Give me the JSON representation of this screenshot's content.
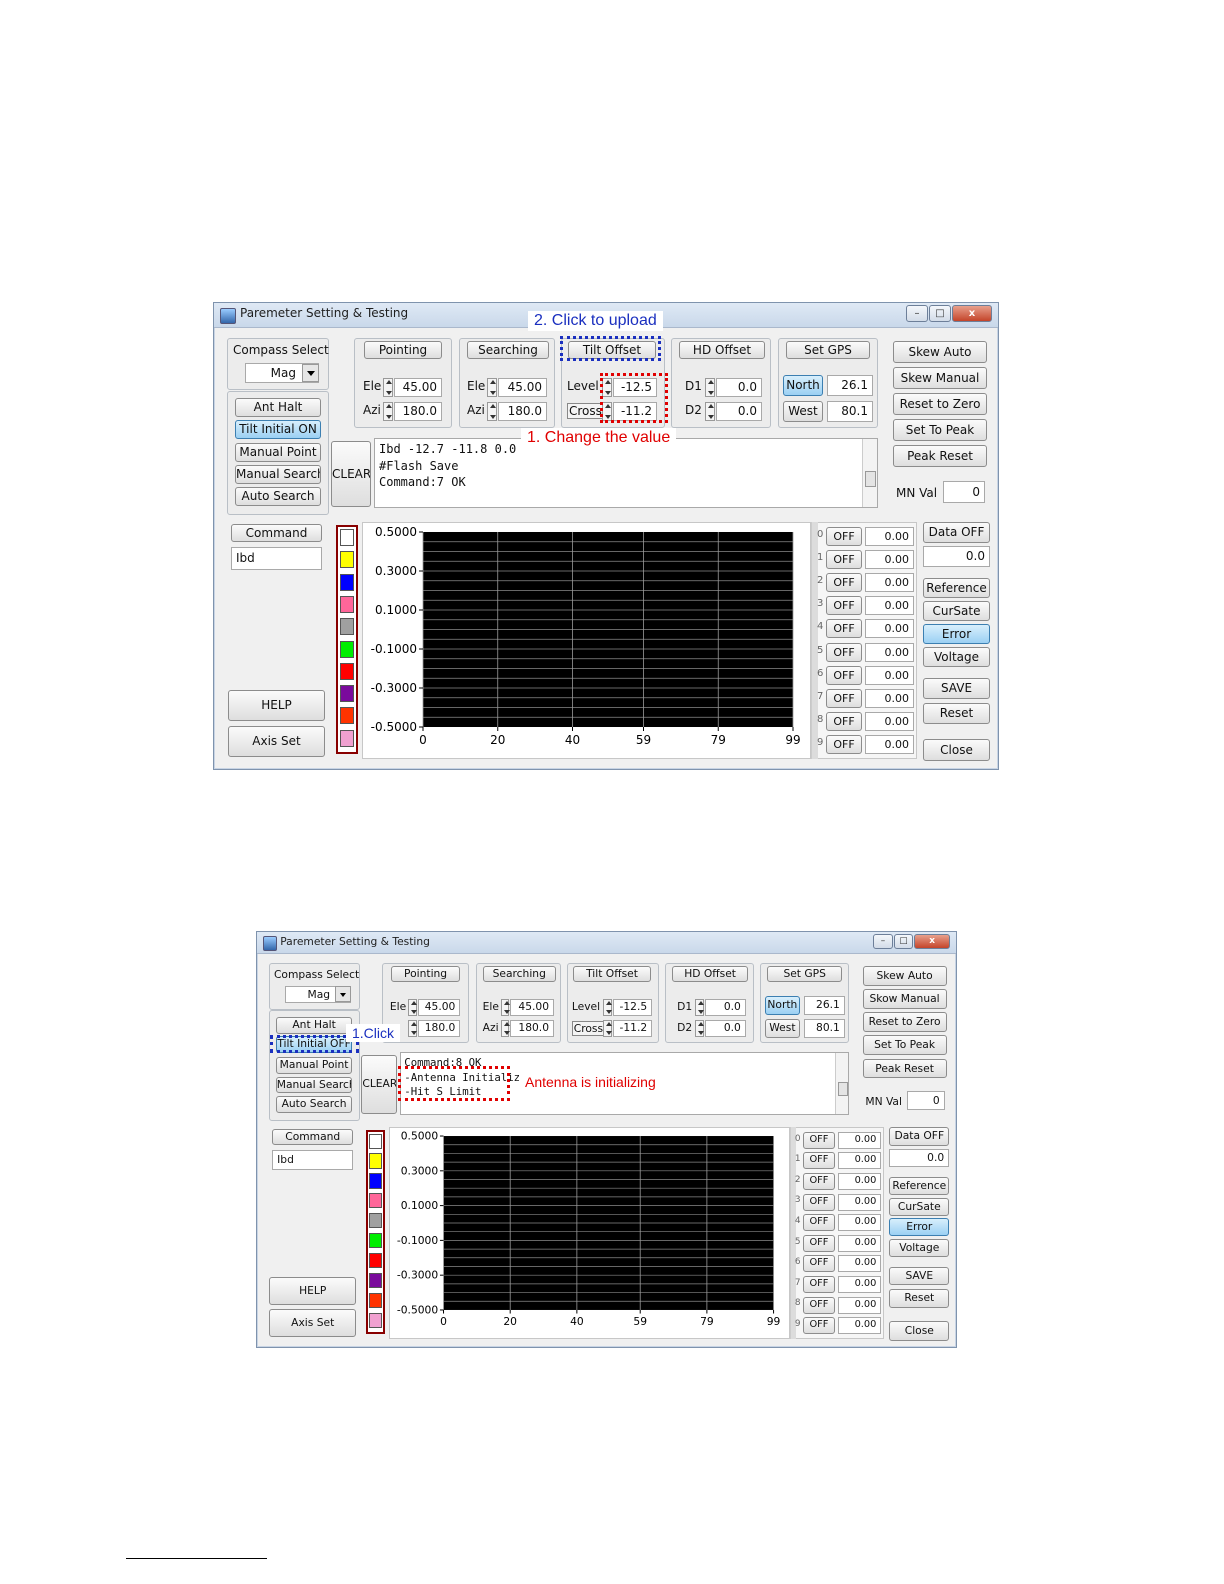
{
  "screens": [
    {
      "title": "Paremeter Setting & Testing",
      "compass": {
        "label": "Compass Select",
        "value": "Mag"
      },
      "left_buttons": [
        "Ant Halt",
        "Tilt Initial ON",
        "Manual Point",
        "Manual Search",
        "Auto Search"
      ],
      "groups": {
        "pointing": {
          "title": "Pointing",
          "ele_label": "Ele",
          "ele": "45.00",
          "azi_label": "Azi",
          "azi": "180.0"
        },
        "searching": {
          "title": "Searching",
          "ele_label": "Ele",
          "ele": "45.00",
          "azi_label": "Azi",
          "azi": "180.0"
        },
        "tilt": {
          "title": "Tilt Offset",
          "level_label": "Level",
          "level": "-12.5",
          "cross_label": "Cross",
          "cross": "-11.2"
        },
        "hd": {
          "title": "HD Offset",
          "d1_label": "D1",
          "d1": "0.0",
          "d2_label": "D2",
          "d2": "0.0"
        },
        "gps": {
          "title": "Set GPS",
          "north_label": "North",
          "north": "26.1",
          "west_label": "West",
          "west": "80.1"
        }
      },
      "right_buttons": [
        "Skew Auto",
        "Skew Manual",
        "Reset to Zero",
        "Set To Peak",
        "Peak Reset"
      ],
      "mn_label": "MN Val",
      "mn_value": "0",
      "clear_label": "CLEAR",
      "log_lines": [
        "Ibd -12.7 -11.8 0.0",
        "#Flash Save",
        "Command:7 OK"
      ],
      "command_label": "Command",
      "command_value": "Ibd",
      "help_label": "HELP",
      "axis_label": "Axis Set",
      "channels": [
        {
          "index": "0",
          "state": "OFF",
          "value": "0.00"
        },
        {
          "index": "1",
          "state": "OFF",
          "value": "0.00"
        },
        {
          "index": "2",
          "state": "OFF",
          "value": "0.00"
        },
        {
          "index": "3",
          "state": "OFF",
          "value": "0.00"
        },
        {
          "index": "4",
          "state": "OFF",
          "value": "0.00"
        },
        {
          "index": "5",
          "state": "OFF",
          "value": "0.00"
        },
        {
          "index": "6",
          "state": "OFF",
          "value": "0.00"
        },
        {
          "index": "7",
          "state": "OFF",
          "value": "0.00"
        },
        {
          "index": "8",
          "state": "OFF",
          "value": "0.00"
        },
        {
          "index": "9",
          "state": "OFF",
          "value": "0.00"
        }
      ],
      "data_off_label": "Data OFF",
      "data_value": "0.0",
      "mode_buttons": [
        "Reference",
        "CurSate",
        "Error",
        "Voltage"
      ],
      "save_label": "SAVE",
      "reset_label": "Reset",
      "close_label": "Close",
      "annotations": [
        "2. Click to upload",
        "1. Change the value"
      ]
    },
    {
      "title": "Paremeter Setting & Testing",
      "compass": {
        "label": "Compass Select",
        "value": "Mag"
      },
      "left_buttons": [
        "Ant Halt",
        "Tilt Initial OFF",
        "Manual Point",
        "Manual Search",
        "Auto Search"
      ],
      "groups": {
        "pointing": {
          "title": "Pointing",
          "ele_label": "Ele",
          "ele": "45.00",
          "azi_label": "",
          "azi": "180.0"
        },
        "searching": {
          "title": "Searching",
          "ele_label": "Ele",
          "ele": "45.00",
          "azi_label": "Azi",
          "azi": "180.0"
        },
        "tilt": {
          "title": "Tilt Offset",
          "level_label": "Level",
          "level": "-12.5",
          "cross_label": "Cross",
          "cross": "-11.2"
        },
        "hd": {
          "title": "HD Offset",
          "d1_label": "D1",
          "d1": "0.0",
          "d2_label": "D2",
          "d2": "0.0"
        },
        "gps": {
          "title": "Set GPS",
          "north_label": "North",
          "north": "26.1",
          "west_label": "West",
          "west": "80.1"
        }
      },
      "right_buttons": [
        "Skew Auto",
        "Skow Manual",
        "Reset to Zero",
        "Set To Peak",
        "Peak Reset"
      ],
      "mn_label": "MN Val",
      "mn_value": "0",
      "clear_label": "CLEAR",
      "log_lines": [
        "Command:8 OK",
        "-Antenna Initialize",
        "-Hit S Limit"
      ],
      "command_label": "Command",
      "command_value": "Ibd",
      "help_label": "HELP",
      "axis_label": "Axis Set",
      "channels": [
        {
          "index": "0",
          "state": "OFF",
          "value": "0.00"
        },
        {
          "index": "1",
          "state": "OFF",
          "value": "0.00"
        },
        {
          "index": "2",
          "state": "OFF",
          "value": "0.00"
        },
        {
          "index": "3",
          "state": "OFF",
          "value": "0.00"
        },
        {
          "index": "4",
          "state": "OFF",
          "value": "0.00"
        },
        {
          "index": "5",
          "state": "OFF",
          "value": "0.00"
        },
        {
          "index": "6",
          "state": "OFF",
          "value": "0.00"
        },
        {
          "index": "7",
          "state": "OFF",
          "value": "0.00"
        },
        {
          "index": "8",
          "state": "OFF",
          "value": "0.00"
        },
        {
          "index": "9",
          "state": "OFF",
          "value": "0.00"
        }
      ],
      "data_off_label": "Data OFF",
      "data_value": "0.0",
      "mode_buttons": [
        "Reference",
        "CurSate",
        "Error",
        "Voltage"
      ],
      "save_label": "SAVE",
      "reset_label": "Reset",
      "close_label": "Close",
      "annotations": [
        "1.Click",
        "Antenna is initializing"
      ]
    }
  ],
  "swatch_colors": [
    "#ffffff",
    "#ffff00",
    "#0000ff",
    "#ff6699",
    "#a0a0a0",
    "#00ee00",
    "#ff0000",
    "#7a0a9c",
    "#ff3300",
    "#f0a0d0"
  ],
  "active_button": {
    "tilt_initial": true,
    "north": true,
    "error": true
  },
  "annotation_colors": {
    "blue": "#1a2fbf",
    "red": "#e00000"
  },
  "chart_data": [
    {
      "type": "line",
      "x_ticks": [
        "0",
        "20",
        "40",
        "59",
        "79",
        "99"
      ],
      "y_ticks": [
        "0.5000",
        "0.3000",
        "0.1000",
        "-0.1000",
        "-0.3000",
        "-0.5000"
      ],
      "ylim": [
        -0.5,
        0.5
      ],
      "xlim": [
        0,
        99
      ],
      "grid": true,
      "background": "#000000",
      "series": []
    },
    {
      "type": "line",
      "x_ticks": [
        "0",
        "20",
        "40",
        "59",
        "79",
        "99"
      ],
      "y_ticks": [
        "0.5000",
        "0.3000",
        "0.1000",
        "-0.1000",
        "-0.3000",
        "-0.5000"
      ],
      "ylim": [
        -0.5,
        0.5
      ],
      "xlim": [
        0,
        99
      ],
      "grid": true,
      "background": "#000000",
      "series": []
    }
  ]
}
